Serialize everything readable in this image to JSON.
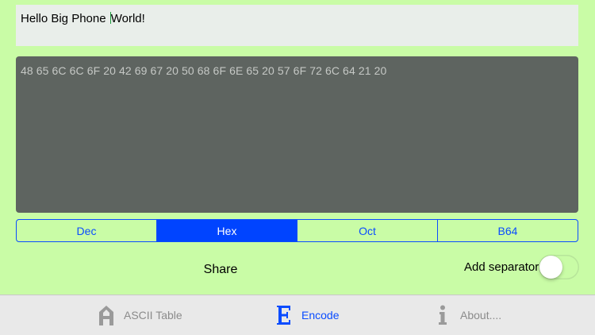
{
  "input": {
    "text_before_caret": "Hello Big Phone ",
    "text_after_caret": "World!"
  },
  "output": {
    "text": "48 65 6C 6C 6F 20 42 69 67 20 50 68 6F 6E 65 20 57 6F 72 6C 64 21 20"
  },
  "encoding": {
    "options": [
      {
        "label": "Dec"
      },
      {
        "label": "Hex"
      },
      {
        "label": "Oct"
      },
      {
        "label": "B64"
      }
    ],
    "selected": "Hex"
  },
  "actions": {
    "share_label": "Share",
    "separator_label": "Add separator",
    "separator_enabled": false
  },
  "tabbar": {
    "items": [
      {
        "label": "ASCII Table",
        "icon": "letter-a-icon",
        "active": false
      },
      {
        "label": "Encode",
        "icon": "letter-e-icon",
        "active": true
      },
      {
        "label": "About....",
        "icon": "info-icon",
        "active": false
      }
    ]
  },
  "colors": {
    "background": "#c9fca6",
    "accent": "#0a4cff",
    "output_background": "#5e6460",
    "inactive_tab": "#8b8b8b"
  }
}
